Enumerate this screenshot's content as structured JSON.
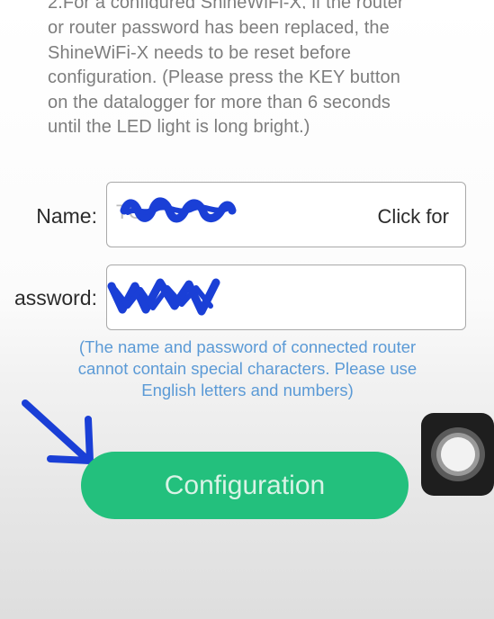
{
  "instructions": {
    "line_cut": "2.For a configured ShineWiFi-X, if the router",
    "lines": [
      "or router password has been replaced, the",
      "ShineWiFi-X needs to be reset before",
      "configuration. (Please press the KEY button",
      "on the datalogger for more than 6 seconds",
      "until the LED light is long bright.)"
    ]
  },
  "form": {
    "name_label": "Name:",
    "name_value": "TC",
    "name_hint": "Click for",
    "password_label": "assword:"
  },
  "note": {
    "lines": [
      "(The name and password of connected router",
      "cannot contain special characters. Please use",
      "English letters and numbers)"
    ]
  },
  "button": {
    "label": "Configuration"
  },
  "colors": {
    "accent_green": "#23c07d",
    "note_blue": "#5b9ad6",
    "scribble_blue": "#1a3fd6"
  },
  "icons": {
    "assistive_touch": "assistive-touch-icon",
    "arrow": "hand-drawn-arrow"
  }
}
